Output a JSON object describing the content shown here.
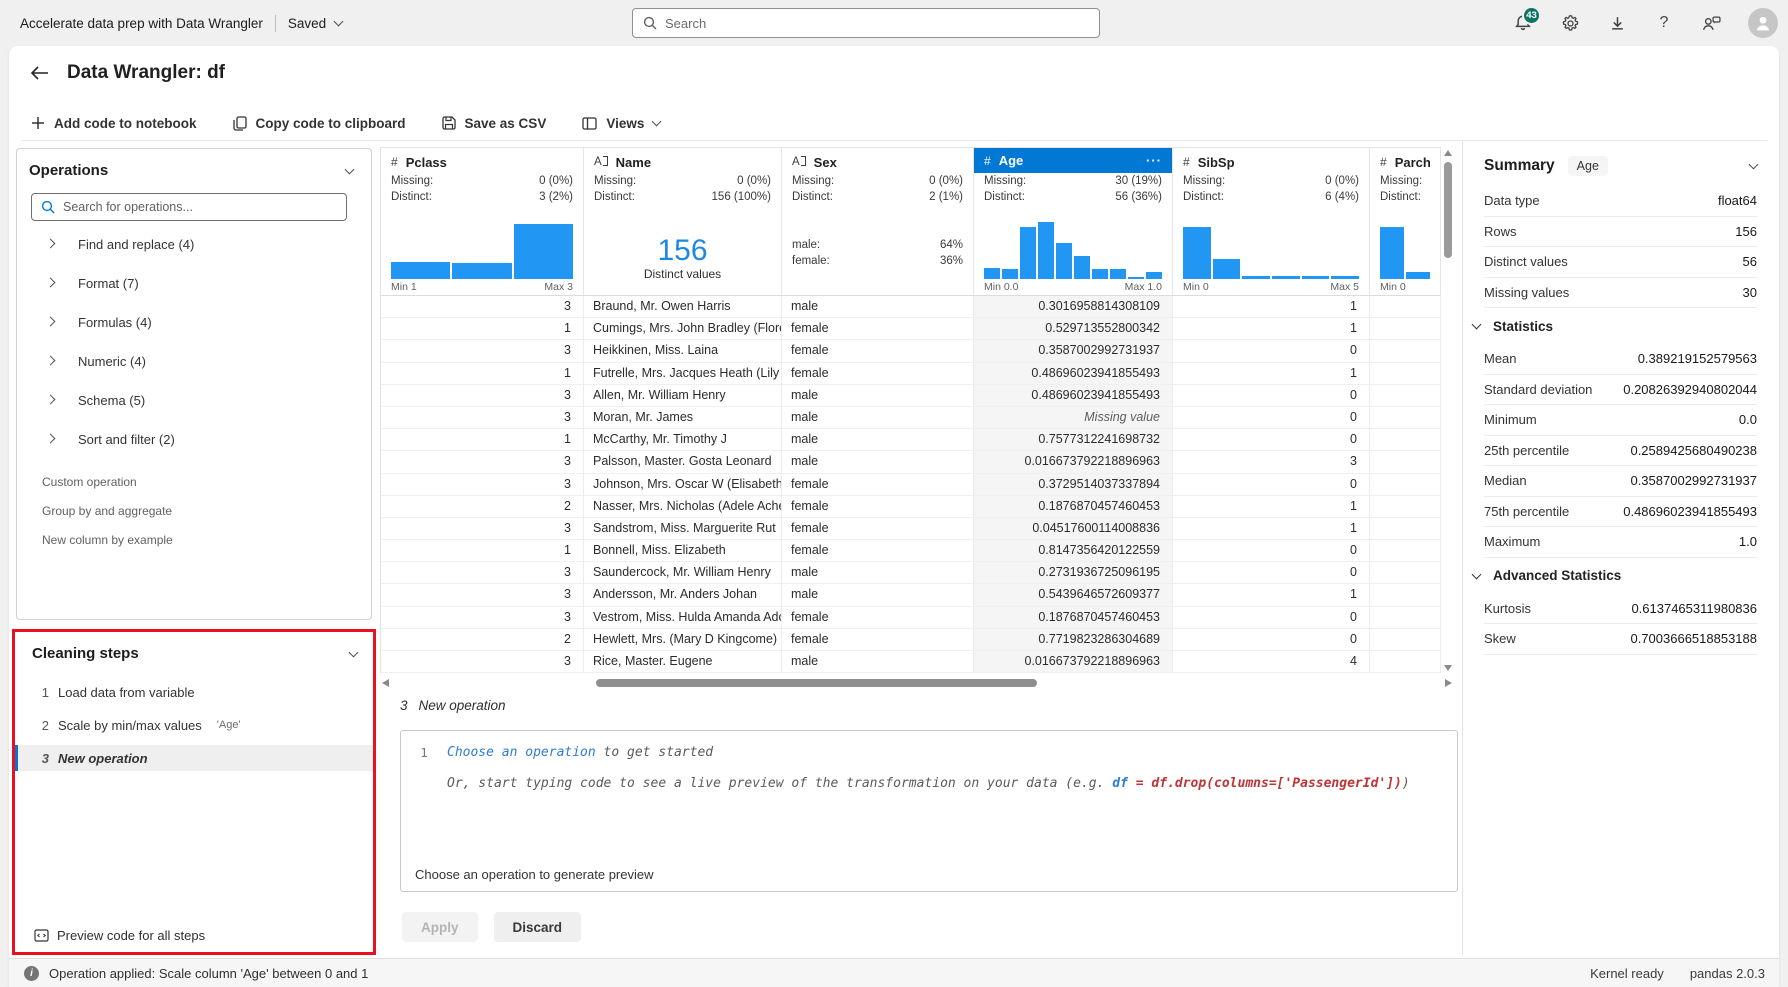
{
  "colors": {
    "accent": "#0078d4",
    "hist": "#2196f3",
    "big_distinct": "#1e88e5",
    "annotation": "#e81123",
    "badge": "#0e7569"
  },
  "icons": {
    "numeric": "#",
    "text": "A",
    "menu": "···",
    "help": "?",
    "info": "i"
  },
  "topbar": {
    "app_title": "Accelerate data prep with Data Wrangler",
    "save_status": "Saved",
    "search_placeholder": "Search",
    "notification_count": "43"
  },
  "header": {
    "title": "Data Wrangler: df"
  },
  "toolbar": {
    "add_code": "Add code to notebook",
    "copy_code": "Copy code to clipboard",
    "save_csv": "Save as CSV",
    "views": "Views"
  },
  "operations": {
    "title": "Operations",
    "search_placeholder": "Search for operations...",
    "groups": [
      "Find and replace (4)",
      "Format (7)",
      "Formulas (4)",
      "Numeric (4)",
      "Schema (5)",
      "Sort and filter (2)"
    ],
    "items": [
      "Custom operation",
      "Group by and aggregate",
      "New column by example"
    ]
  },
  "cleaning_steps": {
    "title": "Cleaning steps",
    "steps": [
      {
        "num": "1",
        "label": "Load data from variable",
        "detail": "",
        "selected": false
      },
      {
        "num": "2",
        "label": "Scale by min/max values",
        "detail": "'Age'",
        "selected": false
      },
      {
        "num": "3",
        "label": "New operation",
        "detail": "",
        "selected": true
      }
    ],
    "footer": "Preview code for all steps"
  },
  "grid": {
    "stat_labels": {
      "missing": "Missing:",
      "distinct": "Distinct:"
    },
    "missing_value_text": "Missing value",
    "columns": [
      {
        "name": "Pclass",
        "type": "num",
        "missing": "0 (0%)",
        "distinct": "3 (2%)",
        "viz": "hist",
        "hist": [
          0.3,
          0.27,
          0.95
        ],
        "min": "Min 1",
        "max": "Max 3",
        "selected": false
      },
      {
        "name": "Name",
        "type": "text",
        "missing": "0 (0%)",
        "distinct": "156 (100%)",
        "viz": "distinct",
        "distinct_big": "156",
        "distinct_label": "Distinct values",
        "selected": false
      },
      {
        "name": "Sex",
        "type": "text",
        "missing": "0 (0%)",
        "distinct": "2 (1%)",
        "viz": "cats",
        "cats": [
          {
            "label": "male:",
            "value": "64%"
          },
          {
            "label": "female:",
            "value": "36%"
          }
        ],
        "selected": false
      },
      {
        "name": "Age",
        "type": "num",
        "missing": "30 (19%)",
        "distinct": "56 (36%)",
        "viz": "hist",
        "hist": [
          0.19,
          0.17,
          0.9,
          0.99,
          0.62,
          0.39,
          0.17,
          0.17,
          0.03,
          0.12
        ],
        "min": "Min 0.0",
        "max": "Max 1.0",
        "selected": true
      },
      {
        "name": "SibSp",
        "type": "num",
        "missing": "0 (0%)",
        "distinct": "6 (4%)",
        "viz": "hist",
        "hist": [
          0.9,
          0.35,
          0.055,
          0.055,
          0.055,
          0.055
        ],
        "min": "Min 0",
        "max": "Max 5",
        "selected": false
      },
      {
        "name": "Parch",
        "type": "num",
        "missing": "",
        "distinct": "",
        "viz": "hist",
        "hist": [
          0.9,
          0.12
        ],
        "min": "Min 0",
        "max": "",
        "selected": false
      }
    ],
    "rows": [
      [
        "3",
        "Braund, Mr. Owen Harris",
        "male",
        "0.3016958814308109",
        "1",
        ""
      ],
      [
        "1",
        "Cumings, Mrs. John Bradley (Florenc",
        "female",
        "0.529713552800342",
        "1",
        ""
      ],
      [
        "3",
        "Heikkinen, Miss. Laina",
        "female",
        "0.3587002992731937",
        "0",
        ""
      ],
      [
        "1",
        "Futrelle, Mrs. Jacques Heath (Lily Ma",
        "female",
        "0.48696023941855493",
        "1",
        ""
      ],
      [
        "3",
        "Allen, Mr. William Henry",
        "male",
        "0.48696023941855493",
        "0",
        ""
      ],
      [
        "3",
        "Moran, Mr. James",
        "male",
        "@missing",
        "0",
        ""
      ],
      [
        "1",
        "McCarthy, Mr. Timothy J",
        "male",
        "0.7577312241698732",
        "0",
        ""
      ],
      [
        "3",
        "Palsson, Master. Gosta Leonard",
        "male",
        "0.016673792218896963",
        "3",
        ""
      ],
      [
        "3",
        "Johnson, Mrs. Oscar W (Elisabeth Vil",
        "female",
        "0.3729514037337894",
        "0",
        ""
      ],
      [
        "2",
        "Nasser, Mrs. Nicholas (Adele Achem",
        "female",
        "0.1876870457460453",
        "1",
        ""
      ],
      [
        "3",
        "Sandstrom, Miss. Marguerite Rut",
        "female",
        "0.04517600114008836",
        "1",
        ""
      ],
      [
        "1",
        "Bonnell, Miss. Elizabeth",
        "female",
        "0.8147356420122559",
        "0",
        ""
      ],
      [
        "3",
        "Saundercock, Mr. William Henry",
        "male",
        "0.2731936725096195",
        "0",
        ""
      ],
      [
        "3",
        "Andersson, Mr. Anders Johan",
        "male",
        "0.5439646572609377",
        "1",
        ""
      ],
      [
        "3",
        "Vestrom, Miss. Hulda Amanda Adolf",
        "female",
        "0.1876870457460453",
        "0",
        ""
      ],
      [
        "2",
        "Hewlett, Mrs. (Mary D Kingcome)",
        "female",
        "0.7719823286304689",
        "0",
        ""
      ],
      [
        "3",
        "Rice, Master. Eugene",
        "male",
        "0.016673792218896963",
        "4",
        ""
      ]
    ]
  },
  "code_panel": {
    "step_num": "3",
    "step_name": "New operation",
    "line_number": "1",
    "hint_link": "Choose an operation",
    "hint_rest": " to get started",
    "hint2_prefix": "Or, start typing code to see a live preview of the transformation on your data (e.g. ",
    "hint2_code_df": "df",
    "hint2_code_rest": " = df.drop(columns=['PassengerId'])",
    "hint2_suffix": ")",
    "preview_hint": "Choose an operation to generate preview",
    "apply_label": "Apply",
    "discard_label": "Discard"
  },
  "summary": {
    "title": "Summary",
    "badge": "Age",
    "info_rows": [
      [
        "Data type",
        "float64"
      ],
      [
        "Rows",
        "156"
      ],
      [
        "Distinct values",
        "56"
      ],
      [
        "Missing values",
        "30"
      ]
    ],
    "sections": [
      {
        "title": "Statistics",
        "rows": [
          [
            "Mean",
            "0.389219152579563"
          ],
          [
            "Standard deviation",
            "0.20826392940802044"
          ],
          [
            "Minimum",
            "0.0"
          ],
          [
            "25th percentile",
            "0.2589425680490238"
          ],
          [
            "Median",
            "0.3587002992731937"
          ],
          [
            "75th percentile",
            "0.48696023941855493"
          ],
          [
            "Maximum",
            "1.0"
          ]
        ]
      },
      {
        "title": "Advanced Statistics",
        "rows": [
          [
            "Kurtosis",
            "0.6137465311980836"
          ],
          [
            "Skew",
            "0.7003666518853188"
          ]
        ]
      }
    ]
  },
  "statusbar": {
    "message": "Operation applied: Scale column 'Age' between 0 and 1",
    "kernel": "Kernel ready",
    "pandas": "pandas 2.0.3"
  }
}
